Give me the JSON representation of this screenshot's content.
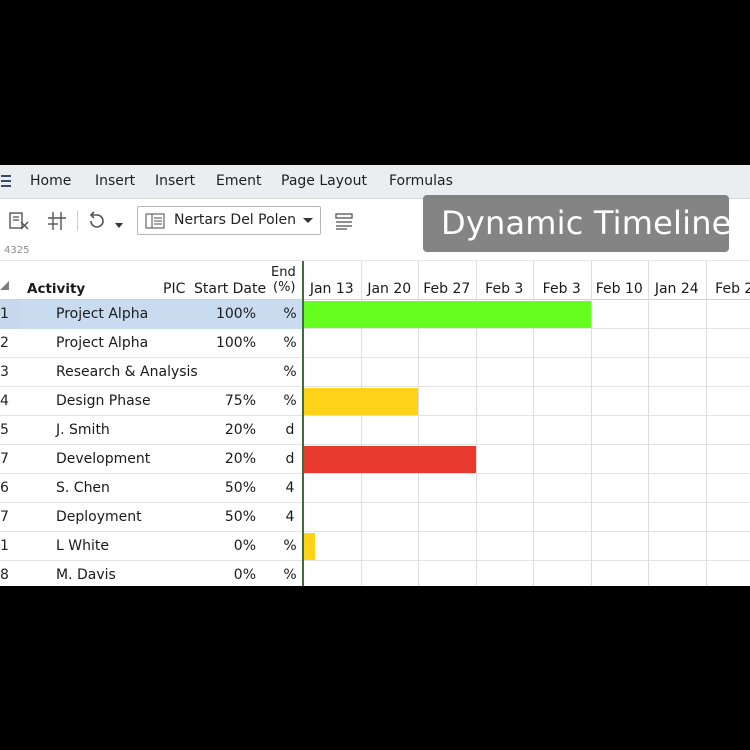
{
  "menu": [
    "Home",
    "Insert",
    "Insert",
    "Ement",
    "Page Layout",
    "Formulas"
  ],
  "toolbar": {
    "font_name": "Nertars Del Polen"
  },
  "overlay_title": "Dynamic Timeline",
  "cell_ref": "4325",
  "columns": {
    "activity": "Activity",
    "pic": "PIC",
    "start_date": "Start Date",
    "end_line1": "End",
    "end_line2": "(%)"
  },
  "timeline_dates": [
    "Jan 13",
    "Jan 20",
    "Feb 27",
    "Feb 3",
    "Feb 3",
    "Feb 10",
    "Jan 24",
    "Feb 2"
  ],
  "rows": [
    {
      "num": "1",
      "activity": "Project Alpha",
      "start": "100%",
      "end": "%"
    },
    {
      "num": "2",
      "activity": "Project Alpha",
      "start": "100%",
      "end": "%"
    },
    {
      "num": "3",
      "activity": "Research & Analysis",
      "start": "",
      "end": "%"
    },
    {
      "num": "4",
      "activity": "Design Phase",
      "start": "75%",
      "end": "%"
    },
    {
      "num": "5",
      "activity": "J. Smith",
      "start": "20%",
      "end": "d"
    },
    {
      "num": "7",
      "activity": "Development",
      "start": "20%",
      "end": "d"
    },
    {
      "num": "6",
      "activity": "S. Chen",
      "start": "50%",
      "end": "4"
    },
    {
      "num": "7",
      "activity": "Deployment",
      "start": "50%",
      "end": "4"
    },
    {
      "num": "1",
      "activity": "L  White",
      "start": "0%",
      "end": "%"
    },
    {
      "num": "8",
      "activity": "M. Davis",
      "start": "0%",
      "end": "%"
    }
  ],
  "bars": [
    {
      "row": 0,
      "start_week": 0,
      "weeks": 5,
      "color": "#66ff1f"
    },
    {
      "row": 3,
      "start_week": 0,
      "weeks": 2,
      "color": "#ffd21a"
    },
    {
      "row": 5,
      "start_week": 0,
      "weeks": 3,
      "color": "#e8392e"
    },
    {
      "row": 8,
      "start_week": 0,
      "weeks": 0.2,
      "color": "#ffd21a"
    }
  ],
  "selected_row": 0
}
